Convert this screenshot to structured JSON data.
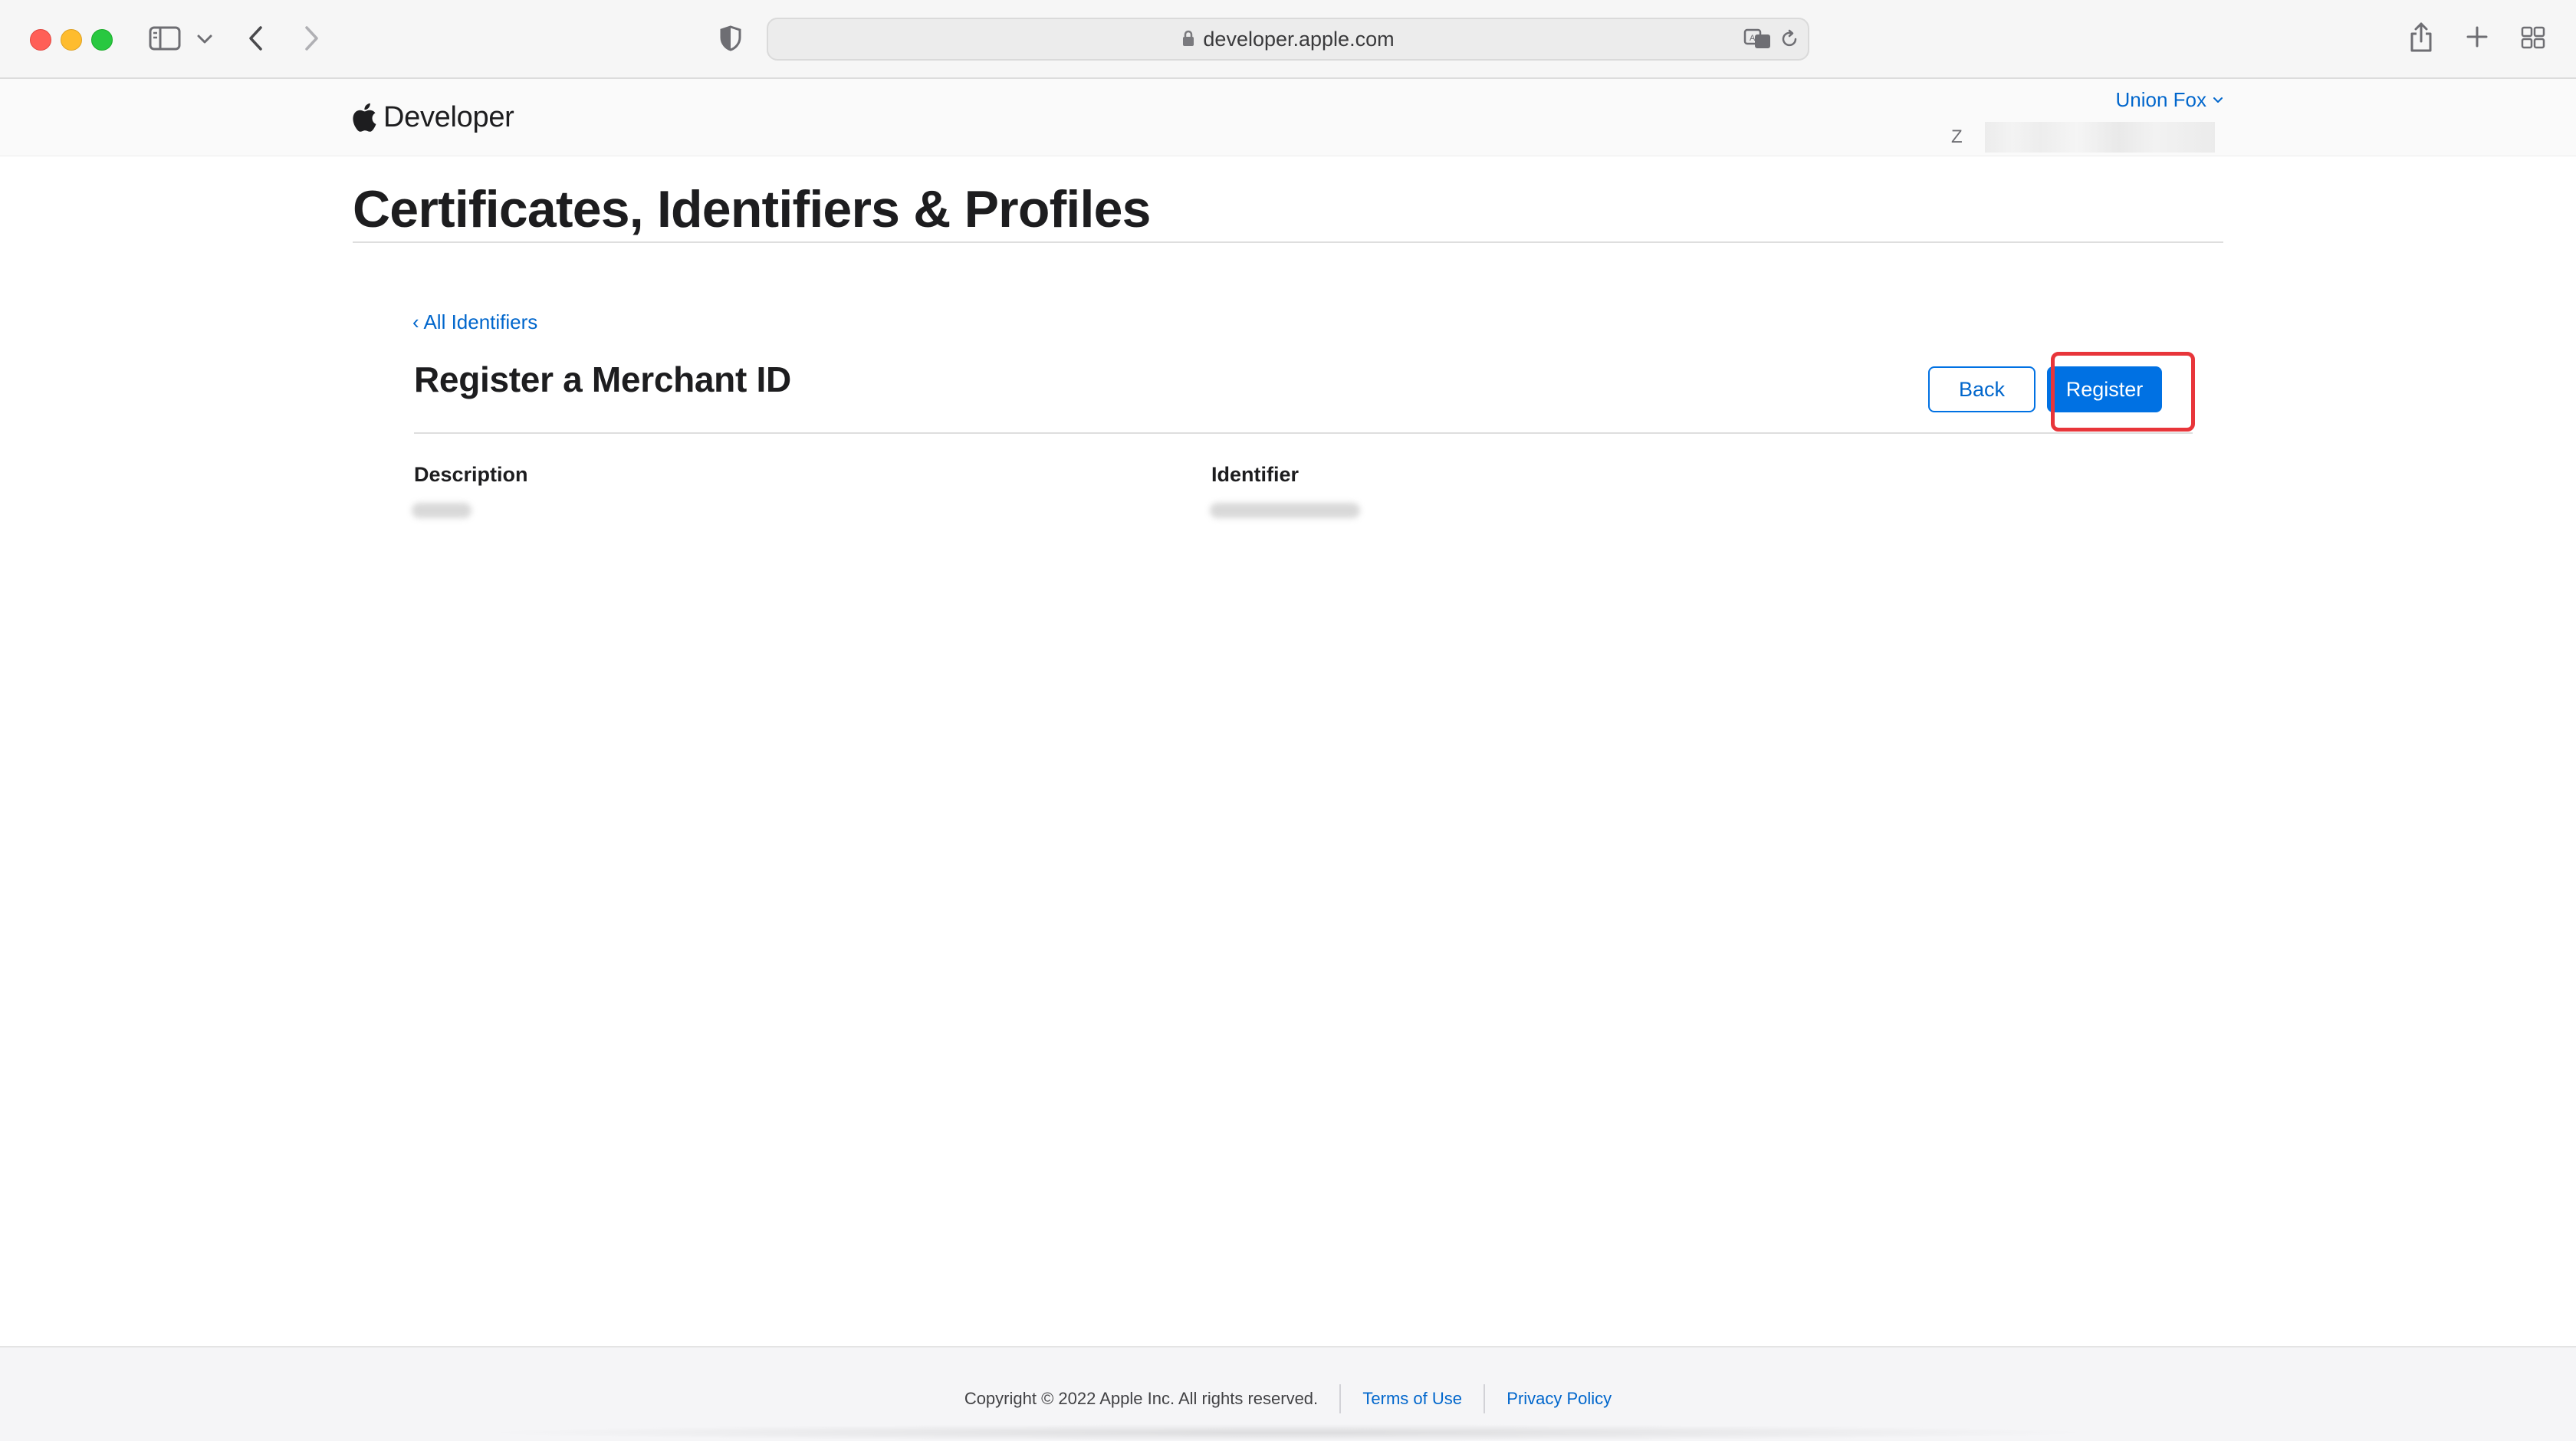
{
  "browser": {
    "url": "developer.apple.com",
    "icons": [
      "sidebar-icon",
      "chevron-down-icon",
      "back-arrow-icon",
      "forward-arrow-icon",
      "shield-icon",
      "lock-icon",
      "translate-icon",
      "reload-icon",
      "share-icon",
      "plus-icon",
      "grid-icon"
    ]
  },
  "header": {
    "logo_text": "Developer",
    "account_name": "Union Fox",
    "team_initial": "Z"
  },
  "page": {
    "title": "Certificates, Identifiers & Profiles",
    "back_link": "‹ All Identifiers",
    "section_title": "Register a Merchant ID",
    "buttons": {
      "back": "Back",
      "register": "Register"
    },
    "fields": {
      "description_label": "Description",
      "identifier_label": "Identifier"
    }
  },
  "footer": {
    "copyright": "Copyright © 2022 Apple Inc. All rights reserved.",
    "terms": "Terms of Use",
    "privacy": "Privacy Policy"
  },
  "colors": {
    "accent": "#0071e3",
    "link": "#0066cc",
    "highlight": "#e8353a"
  }
}
